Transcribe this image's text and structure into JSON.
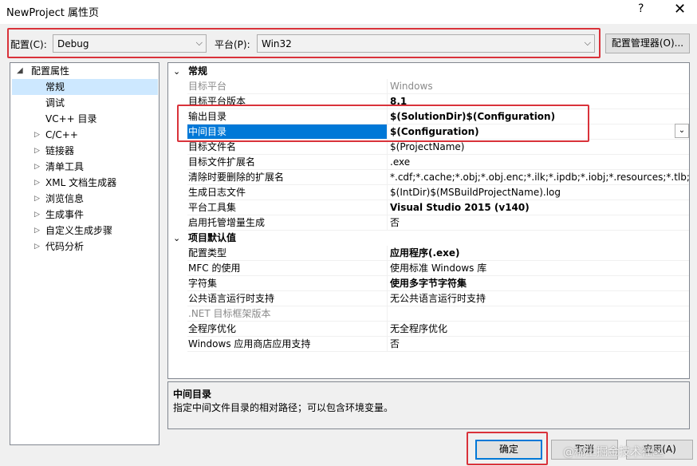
{
  "window": {
    "title": "NewProject 属性页",
    "help_glyph": "?",
    "close_glyph": "✕"
  },
  "toolbar": {
    "config_label": "配置(C):",
    "config_value": "Debug",
    "platform_label": "平台(P):",
    "platform_value": "Win32",
    "manager_button": "配置管理器(O)..."
  },
  "tree": {
    "root": "配置属性",
    "items": [
      {
        "label": "常规",
        "expandable": false,
        "selected": true
      },
      {
        "label": "调试",
        "expandable": false
      },
      {
        "label": "VC++ 目录",
        "expandable": false
      },
      {
        "label": "C/C++",
        "expandable": true
      },
      {
        "label": "链接器",
        "expandable": true
      },
      {
        "label": "清单工具",
        "expandable": true
      },
      {
        "label": "XML 文档生成器",
        "expandable": true
      },
      {
        "label": "浏览信息",
        "expandable": true
      },
      {
        "label": "生成事件",
        "expandable": true
      },
      {
        "label": "自定义生成步骤",
        "expandable": true
      },
      {
        "label": "代码分析",
        "expandable": true
      }
    ]
  },
  "grid": {
    "cat1": "常规",
    "cat1_rows": [
      {
        "name": "目标平台",
        "value": "Windows",
        "dim": true
      },
      {
        "name": "目标平台版本",
        "value": "8.1",
        "bold": true
      },
      {
        "name": "输出目录",
        "value": "$(SolutionDir)$(Configuration)",
        "bold": true
      },
      {
        "name": "中间目录",
        "value": "$(Configuration)",
        "bold": true,
        "selected": true
      },
      {
        "name": "目标文件名",
        "value": "$(ProjectName)"
      },
      {
        "name": "目标文件扩展名",
        "value": ".exe"
      },
      {
        "name": "清除时要删除的扩展名",
        "value": "*.cdf;*.cache;*.obj;*.obj.enc;*.ilk;*.ipdb;*.iobj;*.resources;*.tlb;*.tli;*.t"
      },
      {
        "name": "生成日志文件",
        "value": "$(IntDir)$(MSBuildProjectName).log"
      },
      {
        "name": "平台工具集",
        "value": "Visual Studio 2015 (v140)",
        "bold": true
      },
      {
        "name": "启用托管增量生成",
        "value": "否"
      }
    ],
    "cat2": "项目默认值",
    "cat2_rows": [
      {
        "name": "配置类型",
        "value": "应用程序(.exe)",
        "bold": true
      },
      {
        "name": "MFC 的使用",
        "value": "使用标准 Windows 库"
      },
      {
        "name": "字符集",
        "value": "使用多字节字符集",
        "bold": true
      },
      {
        "name": "公共语言运行时支持",
        "value": "无公共语言运行时支持"
      },
      {
        "name": ".NET 目标框架版本",
        "value": "",
        "dim": true
      },
      {
        "name": "全程序优化",
        "value": "无全程序优化"
      },
      {
        "name": "Windows 应用商店应用支持",
        "value": "否"
      }
    ]
  },
  "description": {
    "title": "中间目录",
    "text": "指定中间文件目录的相对路径；可以包含环境变量。"
  },
  "buttons": {
    "ok": "确定",
    "cancel": "取消",
    "apply": "应用(A)"
  },
  "watermark": "@稀土掘金技术社区"
}
